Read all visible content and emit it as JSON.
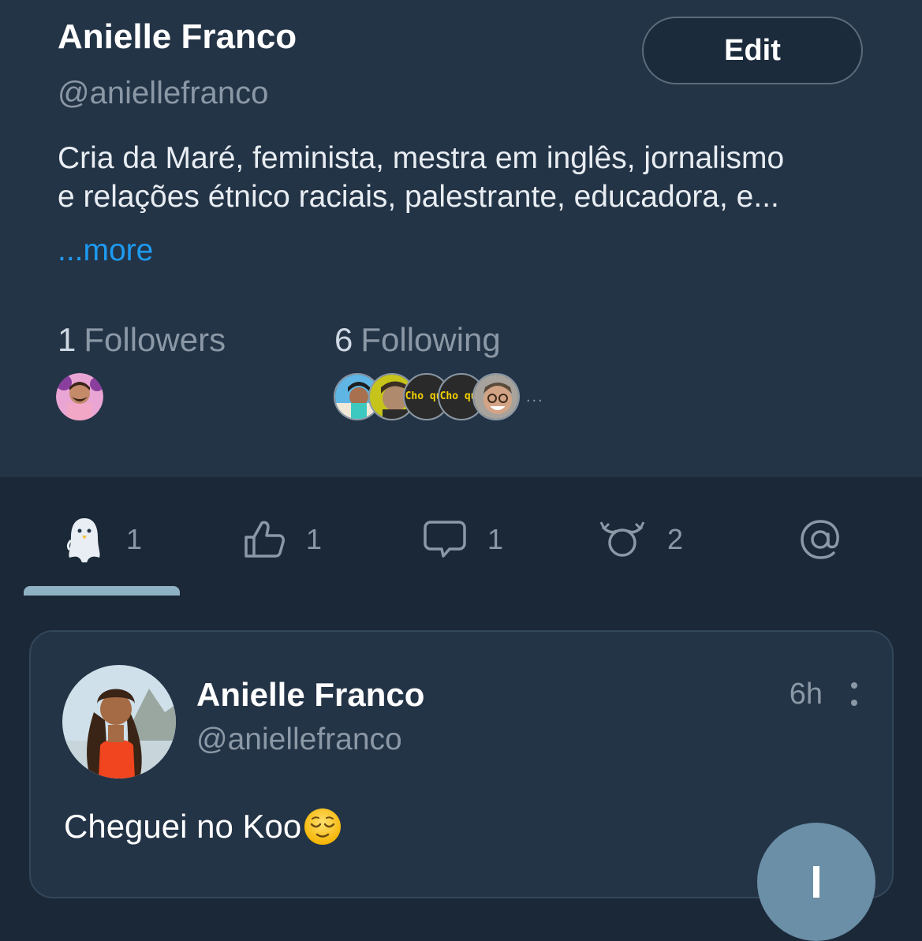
{
  "profile": {
    "name": "Anielle Franco",
    "handle": "@aniellefranco",
    "edit_label": "Edit",
    "bio_line1": "Cria da Maré, feminista, mestra em inglês, jornalismo",
    "bio_line2": "e relações étnico raciais, palestrante, educadora, e...",
    "more_label": "...more"
  },
  "stats": {
    "followers_count": "1",
    "followers_label": "Followers",
    "following_count": "6",
    "following_label": "Following",
    "following_more": "..."
  },
  "avatars": {
    "choque_text": "Cho que"
  },
  "tabs": [
    {
      "icon": "koo-bird-icon",
      "count": "1"
    },
    {
      "icon": "thumbs-up-icon",
      "count": "1"
    },
    {
      "icon": "comment-icon",
      "count": "1"
    },
    {
      "icon": "rekoo-icon",
      "count": "2"
    },
    {
      "icon": "mention-icon",
      "count": ""
    }
  ],
  "post": {
    "author_name": "Anielle Franco",
    "author_handle": "@aniellefranco",
    "time": "6h",
    "text": "Cheguei no Koo",
    "emoji": "relieved-face-icon"
  },
  "colors": {
    "background": "#1b2838",
    "header_bg": "#243447",
    "link": "#1d9bf0",
    "muted": "#8b98a5",
    "tab_indicator": "#8fb1c4",
    "fab": "#6a8fa7"
  }
}
